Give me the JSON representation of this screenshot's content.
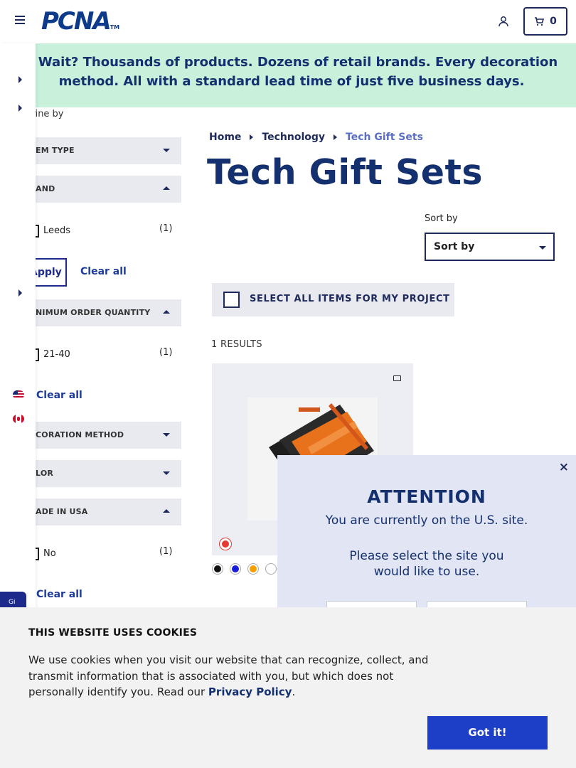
{
  "header": {
    "logo": "PCNA",
    "logo_tm": "TM",
    "cart_count": "0"
  },
  "banner": {
    "text": "y Wait? Thousands of products. Dozens of retail brands. Every decoration method. All with a standard lead time of just five business days."
  },
  "filters": {
    "refine_label": "fine by",
    "item_type": "EM TYPE",
    "brand": "AND",
    "brand_options": [
      {
        "label": "Leeds",
        "count": "(1)"
      }
    ],
    "apply_label": "Apply",
    "clear_all": "Clear all",
    "moq": "NIMUM ORDER QUANTITY",
    "moq_options": [
      {
        "label": "21-40",
        "count": "(1)"
      }
    ],
    "decoration": "CORATION METHOD",
    "color": "LOR",
    "made_in_usa": "ADE IN USA",
    "usa_options": [
      {
        "label": "No",
        "count": "(1)"
      }
    ]
  },
  "breadcrumb": [
    "Home",
    "Technology",
    "Tech Gift Sets"
  ],
  "page_title": "Tech Gift Sets",
  "sort": {
    "label": "Sort by",
    "selected": "Sort by"
  },
  "select_all": "SELECT ALL ITEMS FOR MY PROJECT",
  "results": "1 RESULTS",
  "swatches": [
    "#111111",
    "#1a1adb",
    "#f5a000",
    "#ffffff"
  ],
  "modal": {
    "close": "×",
    "title": "ATTENTION",
    "line1": "You are currently on the U.S. site.",
    "line2a": "Please select the site you",
    "line2b": "would like to use."
  },
  "cookie": {
    "heading": "THIS WEBSITE USES COOKIES",
    "body": "We use cookies when you visit our website that can recognize, collect, and transmit information that is associated with you, but which does not personally identify you. Read our",
    "link": "Privacy Policy",
    "button": "Got it!"
  },
  "gift_tab": "Gi",
  "icons": [
    "hamburger-icon",
    "user-icon",
    "cart-icon",
    "flag-us-icon",
    "flag-ca-icon",
    "folder-icon",
    "close-icon"
  ]
}
